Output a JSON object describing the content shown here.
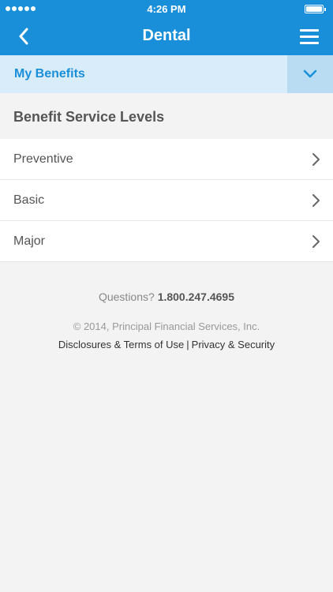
{
  "status_bar": {
    "time": "4:26 PM",
    "signal_dots": 5,
    "battery_level": 1.0
  },
  "nav": {
    "title": "Dental",
    "back_icon": "chevron-left-icon",
    "menu_icon": "hamburger-menu-icon"
  },
  "benefits": {
    "label": "My Benefits",
    "toggle_icon": "chevron-down-icon"
  },
  "section": {
    "title": "Benefit Service Levels"
  },
  "items": [
    {
      "label": "Preventive"
    },
    {
      "label": "Basic"
    },
    {
      "label": "Major"
    }
  ],
  "footer": {
    "questions_label": "Questions?",
    "phone": "1.800.247.4695",
    "copyright": "© 2014, Principal Financial Services, Inc.",
    "disclosures_link": "Disclosures & Terms of Use",
    "separator": "|",
    "privacy_link": "Privacy & Security"
  },
  "colors": {
    "primary": "#1a8fd9",
    "benefits_bg": "#d9ecf9",
    "toggle_bg": "#b9dcf3",
    "page_bg": "#f3f3f3"
  }
}
